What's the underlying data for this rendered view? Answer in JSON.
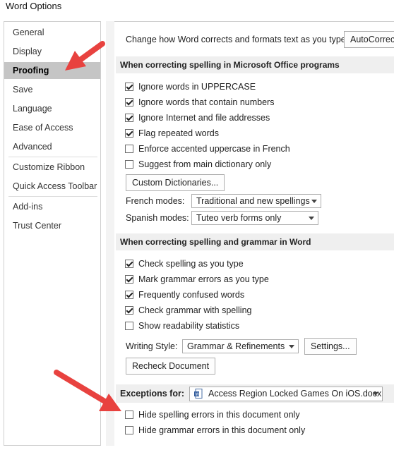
{
  "window": {
    "title": "Word Options"
  },
  "sidebar": {
    "items": [
      {
        "label": "General"
      },
      {
        "label": "Display"
      },
      {
        "label": "Proofing"
      },
      {
        "label": "Save"
      },
      {
        "label": "Language"
      },
      {
        "label": "Ease of Access"
      },
      {
        "label": "Advanced"
      },
      {
        "label": "Customize Ribbon"
      },
      {
        "label": "Quick Access Toolbar"
      },
      {
        "label": "Add-ins"
      },
      {
        "label": "Trust Center"
      }
    ],
    "selected": "Proofing"
  },
  "autocorrect": {
    "text": "Change how Word corrects and formats text as you type:",
    "button": "AutoCorrect Options..."
  },
  "office_section": {
    "title": "When correcting spelling in Microsoft Office programs",
    "checks": [
      {
        "label": "Ignore words in UPPERCASE",
        "checked": true
      },
      {
        "label": "Ignore words that contain numbers",
        "checked": true
      },
      {
        "label": "Ignore Internet and file addresses",
        "checked": true
      },
      {
        "label": "Flag repeated words",
        "checked": true
      },
      {
        "label": "Enforce accented uppercase in French",
        "checked": false
      },
      {
        "label": "Suggest from main dictionary only",
        "checked": false
      }
    ],
    "custom_dict_button": "Custom Dictionaries...",
    "french_label": "French modes:",
    "french_value": "Traditional and new spellings",
    "spanish_label": "Spanish modes:",
    "spanish_value": "Tuteo verb forms only"
  },
  "word_section": {
    "title": "When correcting spelling and grammar in Word",
    "checks": [
      {
        "label": "Check spelling as you type",
        "checked": true
      },
      {
        "label": "Mark grammar errors as you type",
        "checked": true
      },
      {
        "label": "Frequently confused words",
        "checked": true
      },
      {
        "label": "Check grammar with spelling",
        "checked": true
      },
      {
        "label": "Show readability statistics",
        "checked": false
      }
    ],
    "writing_style_label": "Writing Style:",
    "writing_style_value": "Grammar & Refinements",
    "settings_button": "Settings...",
    "recheck_button": "Recheck Document"
  },
  "exceptions": {
    "label": "Exceptions for:",
    "document": "Access Region Locked Games On iOS.docx",
    "checks": [
      {
        "label": "Hide spelling errors in this document only",
        "checked": false
      },
      {
        "label": "Hide grammar errors in this document only",
        "checked": false
      }
    ]
  },
  "colors": {
    "annotation_arrow": "#e8423f",
    "selected_nav": "#c5c5c5",
    "section_header": "#efefef"
  }
}
